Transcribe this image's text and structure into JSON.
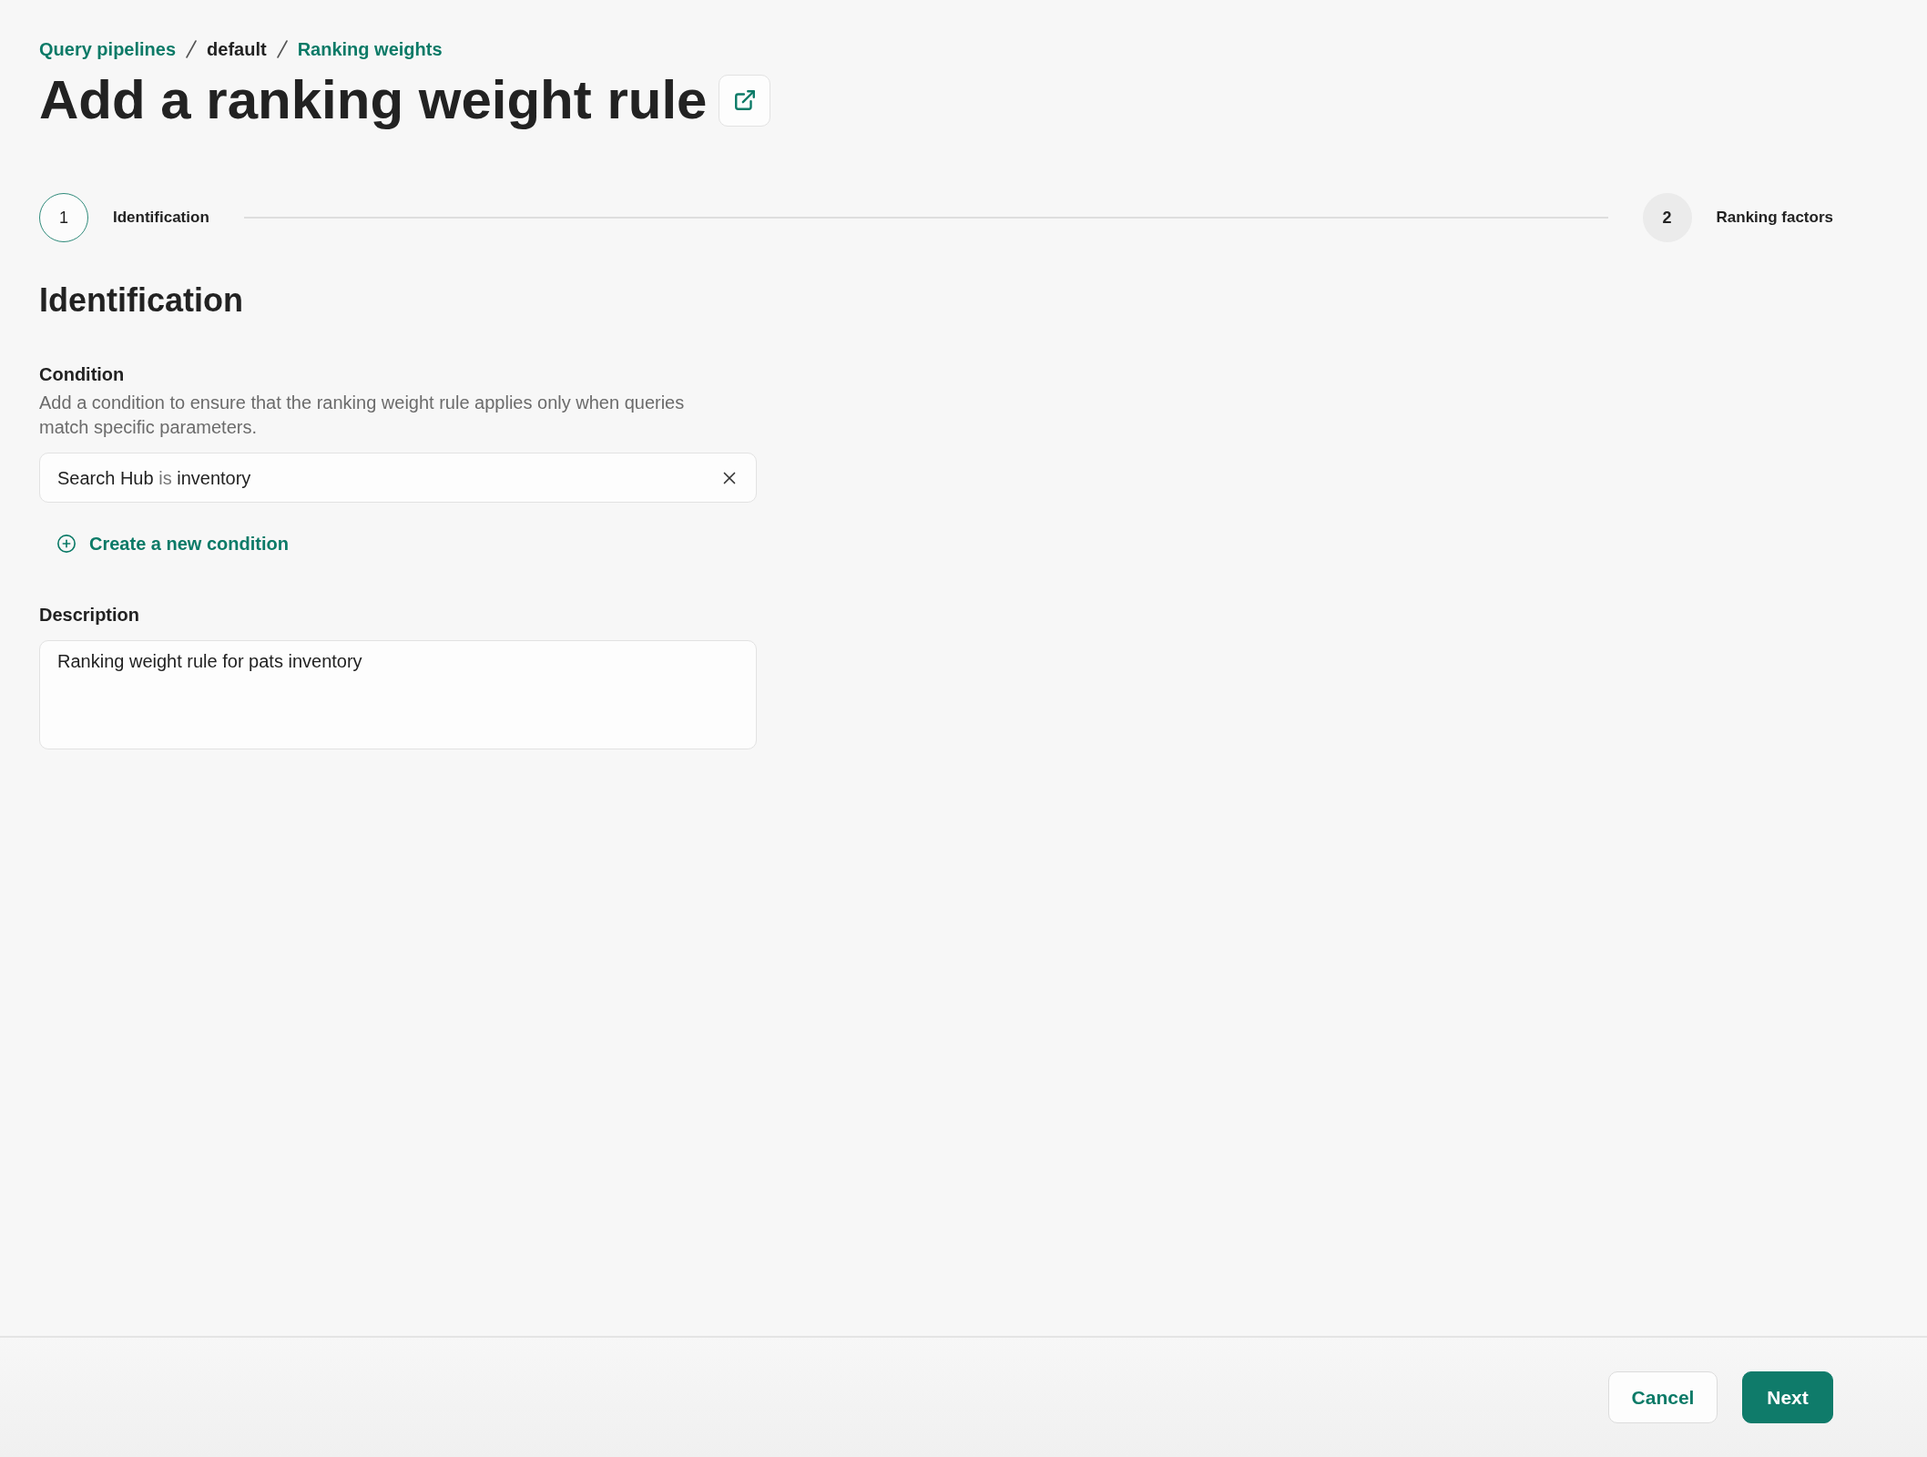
{
  "breadcrumb": [
    {
      "label": "Query pipelines",
      "link": true
    },
    {
      "label": "default",
      "link": false
    },
    {
      "label": "Ranking weights",
      "link": true
    }
  ],
  "title": "Add a ranking weight rule",
  "stepper": {
    "steps": [
      {
        "number": "1",
        "label": "Identification",
        "selected": true
      },
      {
        "number": "2",
        "label": "Ranking factors",
        "selected": false
      }
    ]
  },
  "section": {
    "heading": "Identification",
    "condition": {
      "label": "Condition",
      "help": "Add a condition to ensure that the ranking weight rule applies only when queries match specific parameters.",
      "rules": [
        {
          "field": "Search Hub",
          "operator": "is",
          "value": "inventory"
        }
      ],
      "add_link": "Create a new condition"
    },
    "description": {
      "label": "Description",
      "value": "Ranking weight rule for pats inventory"
    }
  },
  "footer": {
    "buttons": [
      {
        "label": "Cancel",
        "kind": "secondary"
      },
      {
        "label": "Next",
        "kind": "primary"
      }
    ]
  }
}
